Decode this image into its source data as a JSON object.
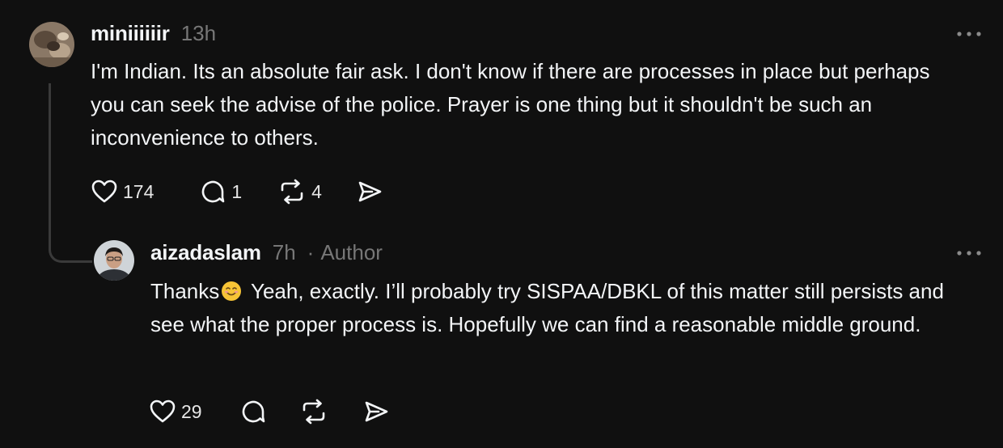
{
  "thread": {
    "parent": {
      "username": "miniiiiiir",
      "time": "13h",
      "text": "I'm Indian. Its an absolute fair ask. I don't know if there are processes in place but perhaps you can seek the advise of the police. Prayer is one thing but it shouldn't be such an inconvenience to others.",
      "likes": "174",
      "replies": "1",
      "reposts": "4",
      "icons": {
        "like": "heart-icon",
        "reply": "comment-icon",
        "repost": "repost-icon",
        "share": "send-icon",
        "more": "more-icon"
      }
    },
    "reply": {
      "username": "aizadaslam",
      "time": "7h",
      "separator": "·",
      "badge": "Author",
      "text_before_emoji": "Thanks",
      "emoji": "smiling-face-emoji",
      "text_after_emoji": " Yeah, exactly. I’ll probably try SISPAA/DBKL of this matter still persists and see what the proper process is. Hopefully we can find a reasonable middle ground.",
      "likes": "29",
      "icons": {
        "like": "heart-icon",
        "reply": "comment-icon",
        "repost": "repost-icon",
        "share": "send-icon",
        "more": "more-icon"
      }
    }
  },
  "colors": {
    "background": "#101010",
    "text": "#f3f5f7",
    "muted": "#777777",
    "thread_line": "#3a3a3a"
  }
}
